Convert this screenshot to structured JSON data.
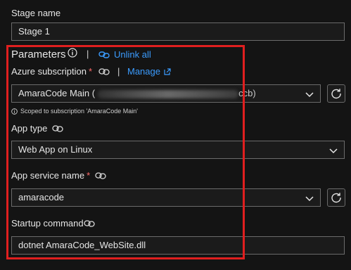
{
  "stage": {
    "name_label": "Stage name",
    "name_value": "Stage 1"
  },
  "parameters": {
    "title": "Parameters",
    "unlink_all": "Unlink all"
  },
  "azure_subscription": {
    "label": "Azure subscription",
    "required_mark": "*",
    "manage_link": "Manage",
    "selected_value": "AmaraCode Main (",
    "selected_value_end": "ccb)",
    "scoped_note": "Scoped to subscription 'AmaraCode Main'"
  },
  "app_type": {
    "label": "App type",
    "selected_value": "Web App on Linux"
  },
  "app_service_name": {
    "label": "App service name",
    "required_mark": "*",
    "selected_value": "amaracode"
  },
  "startup_command": {
    "label": "Startup command",
    "value": "dotnet AmaraCode_WebSite.dll"
  },
  "separators": {
    "pipe": "|"
  },
  "colors": {
    "background": "#141414",
    "link": "#3b9cff",
    "required": "#ff6b6b",
    "highlight_border": "#e01f1f",
    "input_border": "#6b6b6b"
  },
  "icons": {
    "info": "info-icon",
    "link": "link-icon",
    "external": "external-link-icon",
    "refresh": "refresh-icon",
    "chevron": "chevron-down-icon"
  }
}
